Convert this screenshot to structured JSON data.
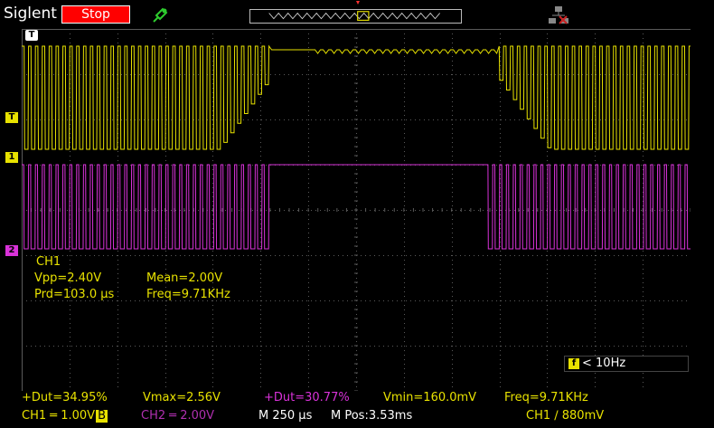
{
  "header": {
    "brand": "Siglent",
    "run_state": "Stop",
    "colors": {
      "run_state_bg": "#ff0000",
      "probe_icon": "#2ecc2e",
      "network_icon": "#cc2222"
    },
    "icons": [
      "probe-icon",
      "network-disconnected-icon",
      "memory-window-icon"
    ]
  },
  "markers": {
    "trigger_top": "T",
    "trigger_level": "T",
    "ch1": "1",
    "ch2": "2"
  },
  "measurements": {
    "source": "CH1",
    "vpp": "Vpp=2.40V",
    "mean": "Mean=2.00V",
    "prd": "Prd=103.0 μs",
    "freq": "Freq=9.71KHz"
  },
  "trigger_freq": {
    "icon_label": "f",
    "value": "< 10Hz"
  },
  "bottom": {
    "row1": {
      "pos_duty_ch1": "+Dut=34.95%",
      "vmax": "Vmax=2.56V",
      "pos_duty_ch2": "+Dut=30.77%",
      "vmin": "Vmin=160.0mV",
      "freq": "Freq=9.71KHz"
    },
    "row2": {
      "ch1_scale": "CH1 ═ 1.00V",
      "bw_badge": "B",
      "ch2_scale": "CH2 ═ 2.00V",
      "timebase": "M 250 μs",
      "mpos": "M Pos:3.53ms",
      "trigger": "CH1 ∕ 880mV"
    }
  },
  "colors": {
    "ch1": "#e8e200",
    "ch2": "#d932d9",
    "grid": "#5a5a5a"
  }
}
